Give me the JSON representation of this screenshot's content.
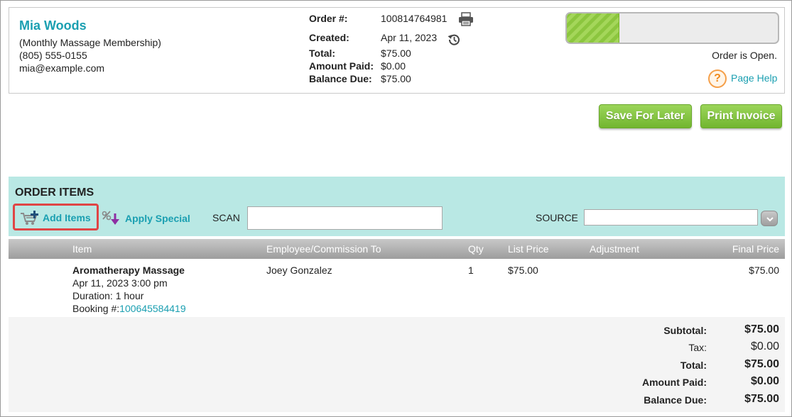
{
  "customer": {
    "name": "Mia Woods",
    "membership": "(Monthly Massage Membership)",
    "phone": "(805) 555-0155",
    "email": "mia@example.com"
  },
  "order": {
    "number_label": "Order #:",
    "number": "100814764981",
    "created_label": "Created:",
    "created": "Apr 11, 2023",
    "total_label": "Total:",
    "total": "$75.00",
    "paid_label": "Amount Paid:",
    "paid": "$0.00",
    "balance_label": "Balance Due:",
    "balance": "$75.00",
    "status_text": "Order is Open.",
    "progress_fraction": 0.25
  },
  "help": {
    "label": "Page Help",
    "icon": "question-icon",
    "icon_glyph": "?"
  },
  "toolbar": {
    "save_label": "Save For Later",
    "print_label": "Print Invoice"
  },
  "items_panel": {
    "title": "ORDER ITEMS",
    "add_items_label": "Add Items",
    "apply_special_label": "Apply Special",
    "scan_label": "SCAN",
    "scan_value": "",
    "source_label": "SOURCE",
    "source_value": ""
  },
  "table": {
    "columns": [
      "Item",
      "Employee/Commission To",
      "Qty",
      "List Price",
      "Adjustment",
      "Final Price"
    ],
    "rows": [
      {
        "item_name": "Aromatherapy Massage",
        "datetime": "Apr 11, 2023 3:00 pm",
        "duration": "Duration: 1 hour",
        "booking_label": "Booking #:",
        "booking_number": "100645584419",
        "employee": "Joey Gonzalez",
        "qty": "1",
        "list_price": "$75.00",
        "adjustment": "",
        "final_price": "$75.00"
      }
    ]
  },
  "totals": {
    "subtotal_label": "Subtotal:",
    "subtotal": "$75.00",
    "tax_label": "Tax:",
    "tax": "$0.00",
    "total_label": "Total:",
    "total": "$75.00",
    "paid_label": "Amount Paid:",
    "paid": "$0.00",
    "balance_label": "Balance Due:",
    "balance": "$75.00"
  },
  "colors": {
    "accent": "#1a9fb1",
    "button_green": "#8cc63f",
    "panel_teal": "#b9e8e4",
    "highlight_red": "#e04545"
  }
}
